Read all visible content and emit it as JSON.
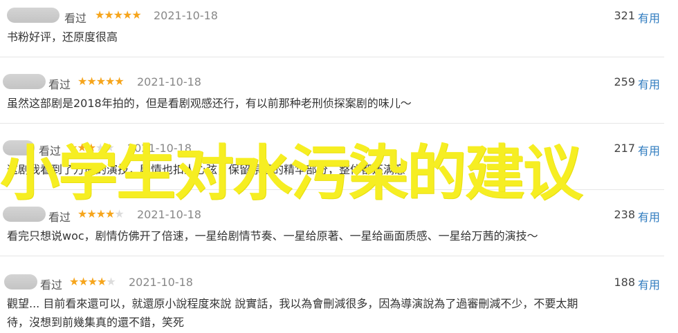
{
  "reviews": [
    {
      "status": "看过",
      "stars": 5,
      "date": "2021-10-18",
      "votes": "321",
      "useful_label": "有用",
      "lines": [
        "书粉好评，还原度很高"
      ]
    },
    {
      "status": "看过",
      "stars": 5,
      "date": "2021-10-18",
      "votes": "259",
      "useful_label": "有用",
      "lines": [
        "虽然这部剧是2018年拍的，但是看剧观感还行，有以前那种老刑侦探案剧的味儿～"
      ]
    },
    {
      "status": "看过",
      "stars": 3,
      "date": "2021-10-18",
      "votes": "217",
      "useful_label": "有用",
      "lines": [
        "这剧我看到了万茜的演技，剧情也扣人心弦，保留原著的精华部分，整体都还满意"
      ]
    },
    {
      "status": "看过",
      "stars": 4,
      "date": "2021-10-18",
      "votes": "238",
      "useful_label": "有用",
      "lines": [
        "看完只想说woc，剧情仿佛开了倍速，一星给剧情节奏、一星给原著、一星给画面质感、一星给万茜的演技～"
      ]
    },
    {
      "status": "看过",
      "stars": 4,
      "date": "2021-10-18",
      "votes": "188",
      "useful_label": "有用",
      "lines": [
        "觀望... 目前看來還可以，就還原小說程度來說 說實話，我以為會刪減很多，因為導演說為了過審刪減不少，不要太期",
        "待，沒想到前幾集真的還不錯，笑死"
      ]
    }
  ],
  "overlay_title": "小学生对水污染的建议",
  "colors": {
    "star": "#f6a51c",
    "useful": "#2f7bbf",
    "overlay": "#f6ee22"
  }
}
